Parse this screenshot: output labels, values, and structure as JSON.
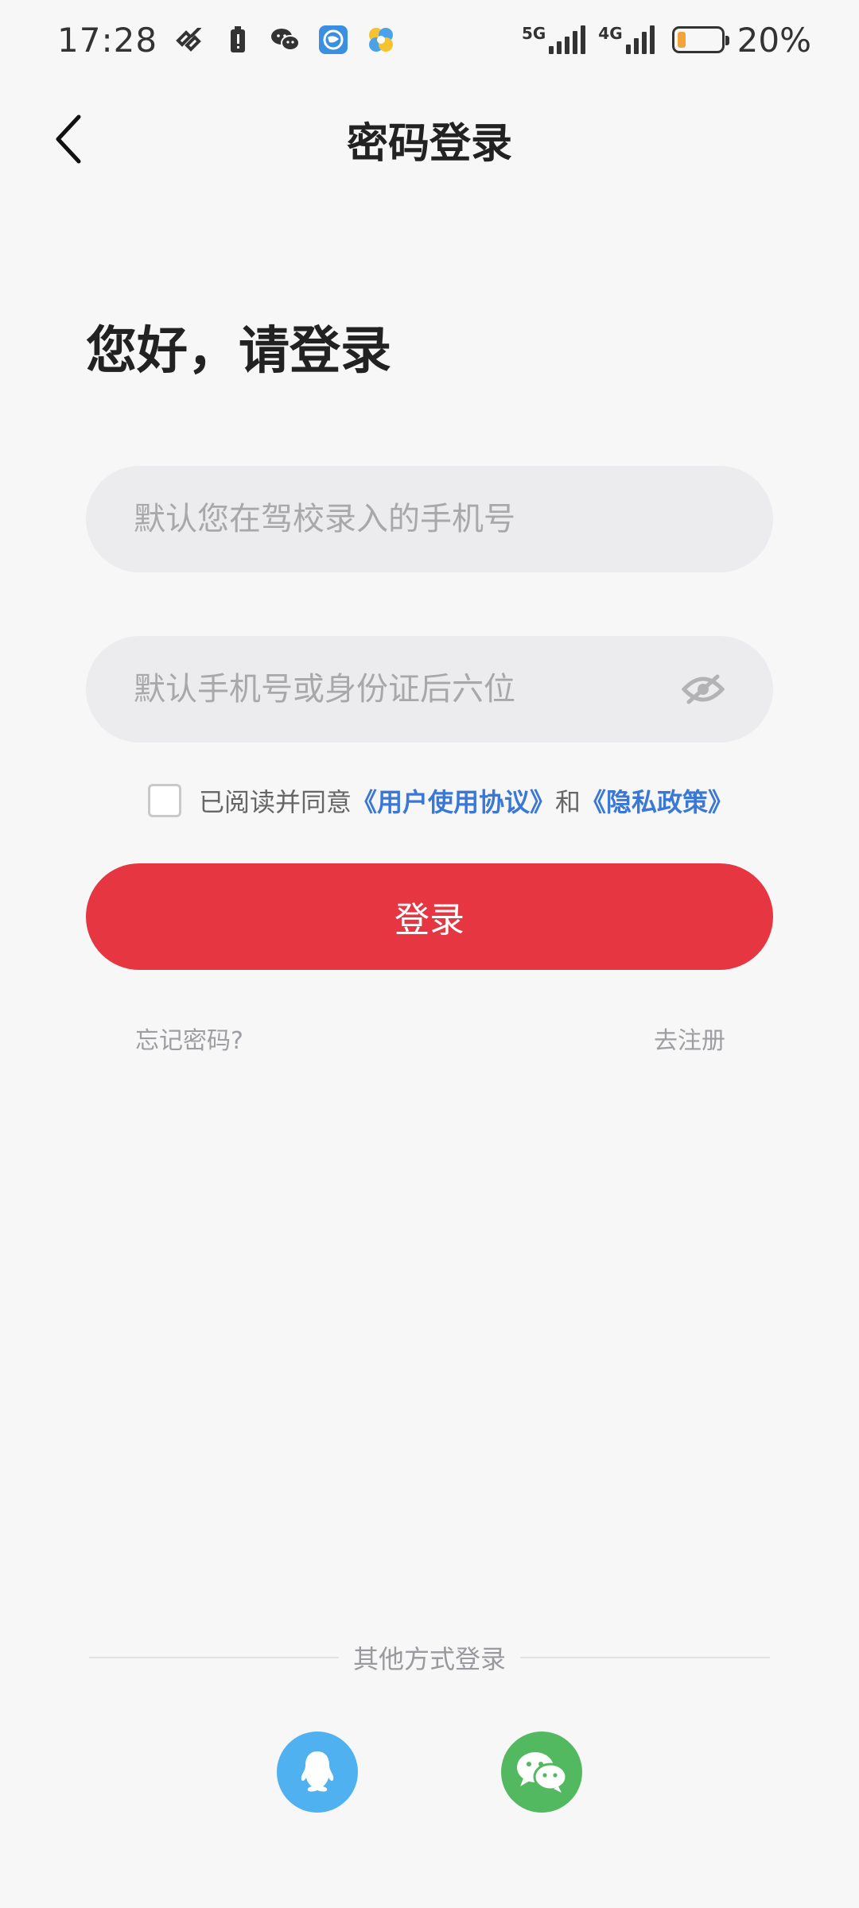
{
  "status_bar": {
    "time": "17:28",
    "network_1": "5G",
    "network_2": "4G",
    "battery_percent": "20%",
    "battery_level": 0.2,
    "icons": [
      "signal-app-icon",
      "battery-alert-icon",
      "wechat-icon",
      "browser-icon",
      "pinwheel-icon"
    ]
  },
  "header": {
    "title": "密码登录",
    "back_icon": "chevron-left-icon"
  },
  "greeting": "您好，请登录",
  "form": {
    "phone_placeholder": "默认您在驾校录入的手机号",
    "password_placeholder": "默认手机号或身份证后六位",
    "password_toggle_icon": "eye-hidden-icon"
  },
  "agreement": {
    "prefix": "已阅读并同意",
    "terms_link": "《用户使用协议》",
    "and": "和",
    "privacy_link": "《隐私政策》",
    "checked": false
  },
  "login_button": "登录",
  "links": {
    "forgot_password": "忘记密码?",
    "register": "去注册"
  },
  "other_login": {
    "label": "其他方式登录",
    "methods": [
      "qq-icon",
      "wechat-icon"
    ]
  },
  "colors": {
    "primary": "#e63642",
    "link": "#3a78d6",
    "qq": "#4fb1ef",
    "wechat": "#53b960"
  }
}
